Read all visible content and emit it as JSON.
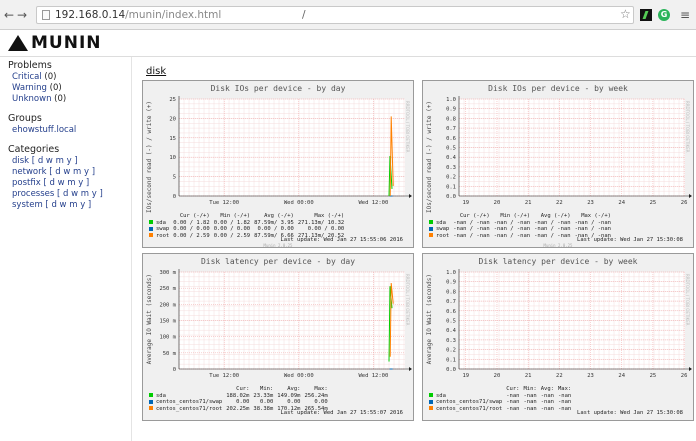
{
  "browser": {
    "url_host": "192.168.0.14",
    "url_path": "/munin/index.html",
    "cursor_char": "/"
  },
  "logo": {
    "name": "MUNIN"
  },
  "sidebar": {
    "problems_heading": "Problems",
    "problems": [
      {
        "label": "Critical",
        "count": "(0)"
      },
      {
        "label": "Warning",
        "count": "(0)"
      },
      {
        "label": "Unknown",
        "count": "(0)"
      }
    ],
    "groups_heading": "Groups",
    "groups": [
      "ehowstuff.local"
    ],
    "categories_heading": "Categories",
    "categories": [
      {
        "name": "disk",
        "links": "[ d w m y ]"
      },
      {
        "name": "network",
        "links": "[ d w m y ]"
      },
      {
        "name": "postfix",
        "links": "[ d w m y ]"
      },
      {
        "name": "processes",
        "links": "[ d w m y ]"
      },
      {
        "name": "system",
        "links": "[ d w m y ]"
      }
    ]
  },
  "section": {
    "title": "disk"
  },
  "panels": [
    {
      "title": "Disk IOs per device - by day",
      "ylabel": "IOs/second read (-) / write (+)",
      "yticks": [
        "25",
        "20",
        "15",
        "10",
        "5",
        "0"
      ],
      "xticks": [
        "Tue 12:00",
        "Wed 00:00",
        "Wed 12:00"
      ],
      "legend_header": [
        "",
        "Cur (-/+)",
        "Min (-/+)",
        "Avg (-/+)",
        "Max (-/+)"
      ],
      "legend": [
        {
          "name": "sda",
          "color": "#00cc00",
          "cur": "0.00 / 1.82",
          "min": "0.00 / 1.82",
          "avg": "87.59m/ 3.95",
          "max": "271.13m/ 10.32"
        },
        {
          "name": "swap",
          "color": "#0066b3",
          "cur": "0.00 / 0.00",
          "min": "0.00 / 0.00",
          "avg": "0.00 / 0.00",
          "max": "0.00 / 0.00"
        },
        {
          "name": "root",
          "color": "#ff8000",
          "cur": "0.00 / 2.59",
          "min": "0.00 / 2.59",
          "avg": "87.59m/ 6.66",
          "max": "271.13m/ 20.52"
        }
      ],
      "last_update": "Last update: Wed Jan 27 15:55:06 2016",
      "version": "Munin 2.0.25",
      "side_text": "RRDTOOL / TOBI OETIKER"
    },
    {
      "title": "Disk IOs per device - by week",
      "ylabel": "IOs/second read (-) / write (+)",
      "yticks": [
        "1.0",
        "0.9",
        "0.8",
        "0.7",
        "0.6",
        "0.5",
        "0.4",
        "0.3",
        "0.2",
        "0.1",
        "0.0"
      ],
      "xticks": [
        "19",
        "20",
        "21",
        "22",
        "23",
        "24",
        "25",
        "26"
      ],
      "legend_header": [
        "",
        "Cur (-/+)",
        "Min (-/+)",
        "Avg (-/+)",
        "Max (-/+)"
      ],
      "legend": [
        {
          "name": "sda",
          "color": "#00cc00",
          "cur": "-nan / -nan",
          "min": "-nan / -nan",
          "avg": "-nan / -nan",
          "max": "-nan / -nan"
        },
        {
          "name": "swap",
          "color": "#0066b3",
          "cur": "-nan / -nan",
          "min": "-nan / -nan",
          "avg": "-nan / -nan",
          "max": "-nan / -nan"
        },
        {
          "name": "root",
          "color": "#ff8000",
          "cur": "-nan / -nan",
          "min": "-nan / -nan",
          "avg": "-nan / -nan",
          "max": "-nan / -nan"
        }
      ],
      "last_update": "Last update: Wed Jan 27 15:30:08",
      "version": "Munin 2.0.25",
      "side_text": "RRDTOOL / TOBI OETIKER"
    },
    {
      "title": "Disk latency per device - by day",
      "ylabel": "Average IO Wait (seconds)",
      "yticks": [
        "300 m",
        "250 m",
        "200 m",
        "150 m",
        "100 m",
        "50 m",
        "0"
      ],
      "xticks": [
        "Tue 12:00",
        "Wed 00:00",
        "Wed 12:00"
      ],
      "legend_header": [
        "",
        "Cur:",
        "Min:",
        "Avg:",
        "Max:"
      ],
      "legend": [
        {
          "name": "sda",
          "color": "#00cc00",
          "cur": "188.02m",
          "min": "23.33m",
          "avg": "149.09m",
          "max": "256.24m"
        },
        {
          "name": "centos_centos71/swap",
          "color": "#0066b3",
          "cur": "0.00",
          "min": "0.00",
          "avg": "0.00",
          "max": "0.00"
        },
        {
          "name": "centos_centos71/root",
          "color": "#ff8000",
          "cur": "202.25m",
          "min": "38.38m",
          "avg": "170.12m",
          "max": "265.54m"
        }
      ],
      "last_update": "Last update: Wed Jan 27 15:55:07 2016",
      "version": "",
      "side_text": "RRDTOOL / TOBI OETIKER"
    },
    {
      "title": "Disk latency per device - by week",
      "ylabel": "Average IO Wait (seconds)",
      "yticks": [
        "1.0",
        "0.9",
        "0.8",
        "0.7",
        "0.6",
        "0.5",
        "0.4",
        "0.3",
        "0.2",
        "0.1",
        "0.0"
      ],
      "xticks": [
        "19",
        "20",
        "21",
        "22",
        "23",
        "24",
        "25",
        "26"
      ],
      "legend_header": [
        "",
        "Cur:",
        "Min:",
        "Avg:",
        "Max:"
      ],
      "legend": [
        {
          "name": "sda",
          "color": "#00cc00",
          "cur": "-nan",
          "min": "-nan",
          "avg": "-nan",
          "max": "-nan"
        },
        {
          "name": "centos_centos71/swap",
          "color": "#0066b3",
          "cur": "-nan",
          "min": "-nan",
          "avg": "-nan",
          "max": "-nan"
        },
        {
          "name": "centos_centos71/root",
          "color": "#ff8000",
          "cur": "-nan",
          "min": "-nan",
          "avg": "-nan",
          "max": "-nan"
        }
      ],
      "last_update": "Last update: Wed Jan 27 15:30:08",
      "version": "",
      "side_text": "RRDTOOL / TOBI OETIKER"
    }
  ],
  "chart_data": [
    {
      "type": "line",
      "title": "Disk IOs per device - by day",
      "ylabel": "IOs/second read (-) / write (+)",
      "ylim": [
        0,
        25
      ],
      "x": [
        "Tue 12:00",
        "Wed 00:00",
        "Wed 12:00"
      ],
      "series": [
        {
          "name": "sda",
          "values_tail": [
            0,
            10.32,
            1.82
          ]
        },
        {
          "name": "swap",
          "values_tail": [
            0,
            0,
            0
          ]
        },
        {
          "name": "root",
          "values_tail": [
            0,
            20.52,
            2.59
          ]
        }
      ]
    },
    {
      "type": "line",
      "title": "Disk IOs per device - by week",
      "ylim": [
        0,
        1.0
      ],
      "x": [
        "19",
        "20",
        "21",
        "22",
        "23",
        "24",
        "25",
        "26"
      ],
      "series": []
    },
    {
      "type": "line",
      "title": "Disk latency per device - by day",
      "ylabel": "Average IO Wait (seconds)",
      "ylim": [
        0,
        0.3
      ],
      "x": [
        "Tue 12:00",
        "Wed 00:00",
        "Wed 12:00"
      ],
      "series": [
        {
          "name": "sda",
          "values_tail": [
            0.023,
            0.256,
            0.188
          ]
        },
        {
          "name": "centos_centos71/swap",
          "values_tail": [
            0,
            0,
            0
          ]
        },
        {
          "name": "centos_centos71/root",
          "values_tail": [
            0.038,
            0.266,
            0.202
          ]
        }
      ]
    },
    {
      "type": "line",
      "title": "Disk latency per device - by week",
      "ylim": [
        0,
        1.0
      ],
      "x": [
        "19",
        "20",
        "21",
        "22",
        "23",
        "24",
        "25",
        "26"
      ],
      "series": []
    }
  ]
}
